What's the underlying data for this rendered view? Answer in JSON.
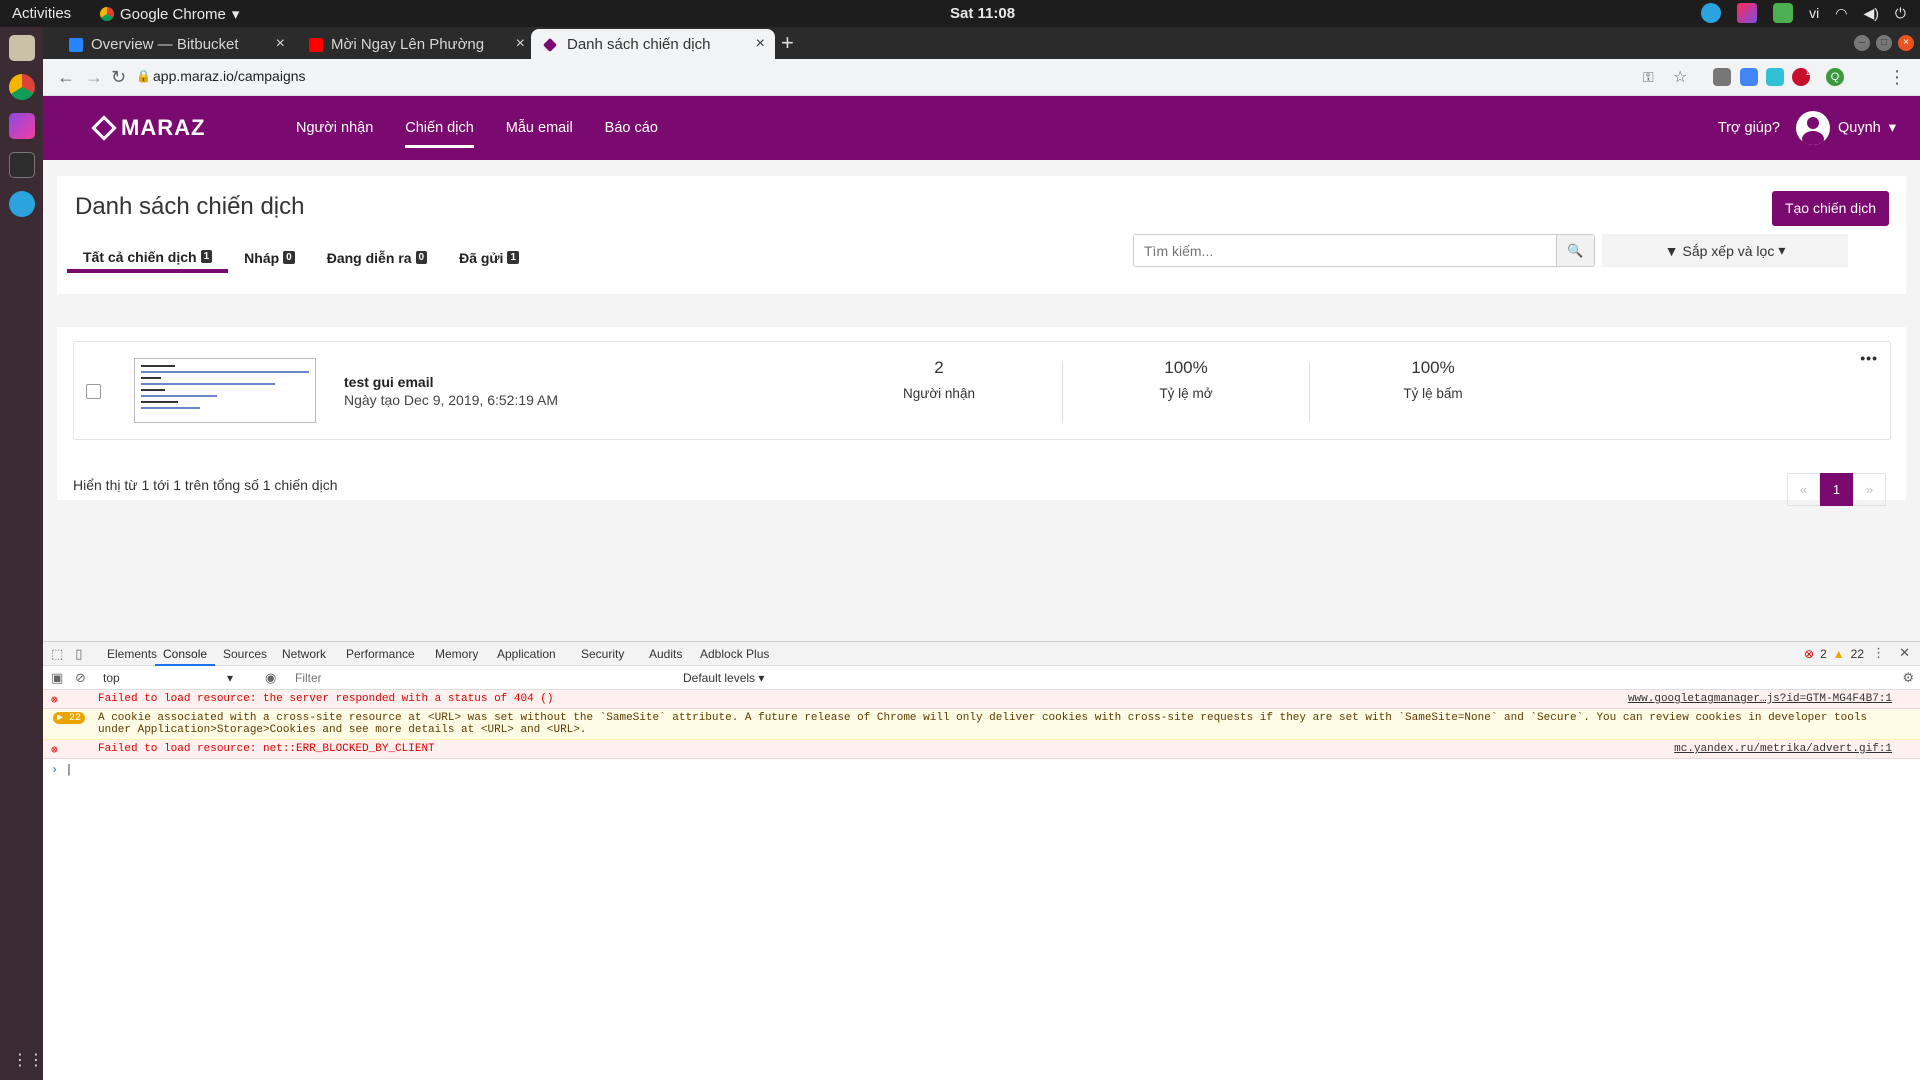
{
  "os": {
    "activities": "Activities",
    "app_name": "Google Chrome",
    "clock": "Sat 11:08",
    "lang": "vi"
  },
  "browser": {
    "tabs": [
      {
        "title": "Overview — Bitbucket"
      },
      {
        "title": "Mời Ngay Lên Phường"
      },
      {
        "title": "Danh sách chiến dịch"
      }
    ],
    "url": "app.maraz.io/campaigns",
    "profile_letter": "Q",
    "adblock_count": "1"
  },
  "app": {
    "brand": "MARAZ",
    "brand_color": "#7a0a6f",
    "menu": [
      "Người nhận",
      "Chiến dịch",
      "Mẫu email",
      "Báo cáo"
    ],
    "help": "Trợ giúp?",
    "user": "Quynh"
  },
  "campaigns": {
    "title": "Danh sách chiến dịch",
    "create_button": "Tạo chiến dịch",
    "tabs": [
      {
        "label": "Tất cả chiến dịch",
        "count": "1"
      },
      {
        "label": "Nháp",
        "count": "0"
      },
      {
        "label": "Đang diễn ra",
        "count": "0"
      },
      {
        "label": "Đã gửi",
        "count": "1"
      }
    ],
    "search_placeholder": "Tìm kiếm...",
    "sort_label": "Sắp xếp và lọc",
    "items": [
      {
        "name": "test gui email",
        "created": "Ngày tạo Dec 9, 2019, 6:52:19 AM",
        "recipients_value": "2",
        "recipients_label": "Người nhận",
        "open_value": "100%",
        "open_label": "Tỷ lệ mở",
        "click_value": "100%",
        "click_label": "Tỷ lệ bấm"
      }
    ],
    "summary": "Hiển thị từ 1 tới 1 trên tổng số 1 chiến dịch",
    "pager": {
      "prev": "«",
      "current": "1",
      "next": "»"
    }
  },
  "devtools": {
    "tabs": [
      "Elements",
      "Console",
      "Sources",
      "Network",
      "Performance",
      "Memory",
      "Application",
      "Security",
      "Audits",
      "Adblock Plus"
    ],
    "error_count": "2",
    "warning_count": "22",
    "context": "top",
    "filter_placeholder": "Filter",
    "levels": "Default levels",
    "messages": [
      {
        "type": "error",
        "text": "Failed to load resource: the server responded with a status of 404 ()",
        "source": "www.googletagmanager…js?id=GTM-MG4F4B7:1"
      },
      {
        "type": "warning",
        "count": "22",
        "text": "A cookie associated with a cross-site resource at <URL> was set without the `SameSite` attribute. A future release of Chrome will only deliver cookies with cross-site requests if they are set with `SameSite=None` and `Secure`. You can review cookies in developer tools under Application>Storage>Cookies and see more details at <URL> and <URL>.",
        "source": ""
      },
      {
        "type": "error",
        "text": "Failed to load resource: net::ERR_BLOCKED_BY_CLIENT",
        "source": "mc.yandex.ru/metrika/advert.gif:1"
      }
    ]
  }
}
